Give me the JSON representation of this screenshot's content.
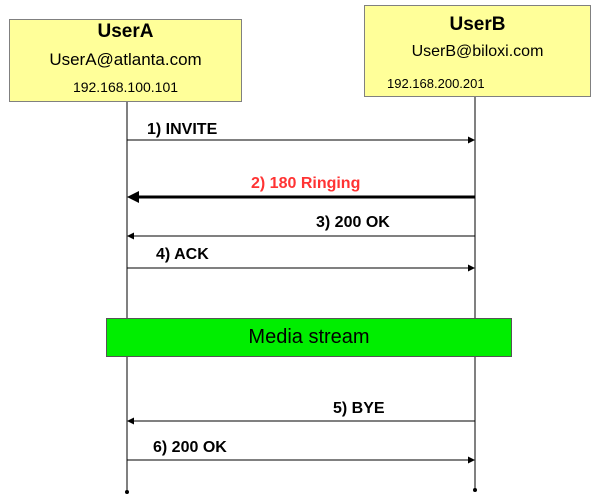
{
  "endpoints": {
    "userA": {
      "name": "UserA",
      "uri": "UserA@atlanta.com",
      "ip": "192.168.100.101"
    },
    "userB": {
      "name": "UserB",
      "uri": "UserB@biloxi.com",
      "ip": "192.168.200.201"
    }
  },
  "messages": [
    {
      "label": "1) INVITE",
      "direction": "A-to-B",
      "highlight": false
    },
    {
      "label": "2) 180 Ringing",
      "direction": "B-to-A",
      "highlight": true
    },
    {
      "label": "3) 200 OK",
      "direction": "B-to-A",
      "highlight": false
    },
    {
      "label": "4) ACK",
      "direction": "A-to-B",
      "highlight": false
    },
    {
      "label": "5) BYE",
      "direction": "B-to-A",
      "highlight": false
    },
    {
      "label": "6) 200 OK",
      "direction": "A-to-B",
      "highlight": false
    }
  ],
  "media": {
    "label": "Media stream",
    "color": "#00ee00"
  },
  "colors": {
    "endpoint_fill": "#ffff99",
    "highlight_text": "#ff3333"
  }
}
